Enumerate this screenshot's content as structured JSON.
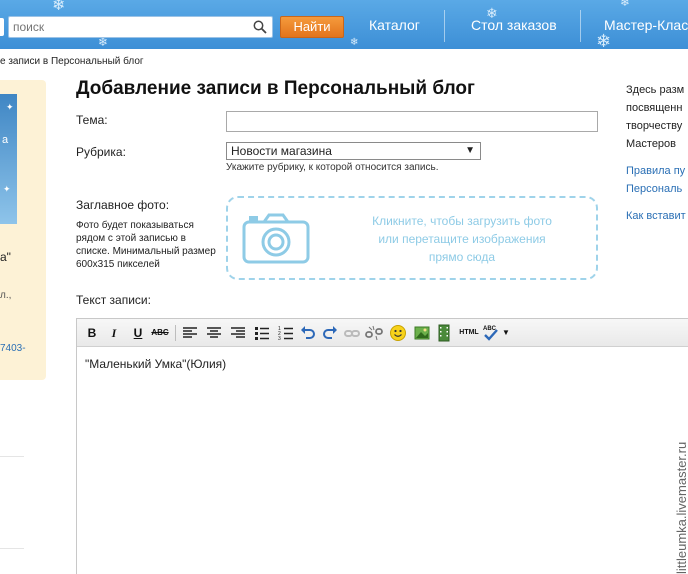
{
  "header": {
    "search": {
      "placeholder": "поиск",
      "value": ""
    },
    "find_label": "Найти",
    "nav": [
      "Каталог",
      "Стол заказов",
      "Мастер-Клас"
    ],
    "colors": {
      "bar": "#4a9ee0",
      "find_button": "#ea7f26"
    }
  },
  "breadcrumb": "е записи в Персональный блог",
  "left_panel": {
    "img_text": "а",
    "name": "а\"",
    "meta": "л.,",
    "phone": "7403-"
  },
  "form": {
    "title": "Добавление записи в Персональный блог",
    "topic_label": "Тема:",
    "topic_value": "",
    "rubric_label": "Рубрика:",
    "rubric_value": "Новости магазина",
    "rubric_hint": "Укажите рубрику, к которой относится запись.",
    "photo_label": "Заглавное фото:",
    "photo_desc": "Фото будет показываться рядом с этой записью в списке. Минимальный размер 600x315 пикселей",
    "dropzone": {
      "line1": "Кликните, чтобы загрузить фото",
      "line2": "или перетащите изображения",
      "line3": "прямо сюда"
    },
    "text_label": "Текст записи:",
    "editor_text": "\"Маленький Умка\"(Юлия)",
    "toolbar": {
      "bold": "B",
      "italic": "I",
      "underline": "U",
      "strike": "ABC",
      "html": "HTML",
      "spell": "ABC"
    }
  },
  "sidebar_right": {
    "text_lines": [
      "Здесь разм",
      "посвященн",
      "творчеству",
      "Мастеров"
    ],
    "link1_lines": [
      "Правила пу",
      "Персональ"
    ],
    "link2": "Как вставит"
  },
  "watermark": "littleumka.livemaster.ru"
}
